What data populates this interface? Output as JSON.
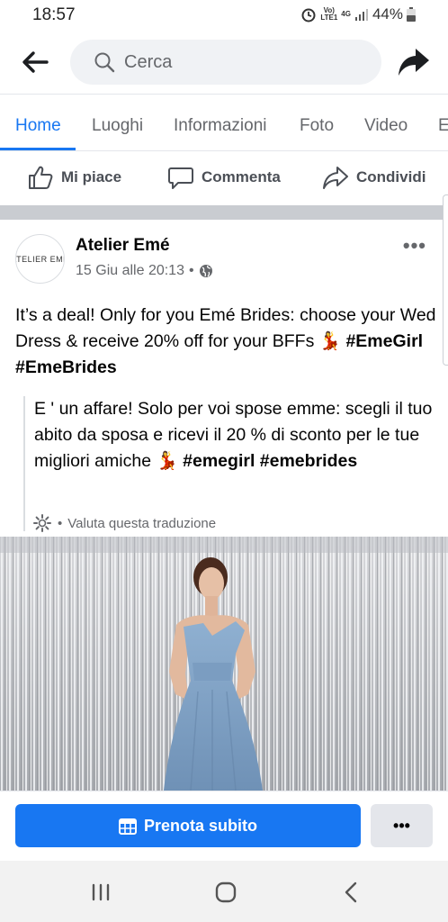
{
  "status": {
    "time": "18:57",
    "net_top": "Vo)",
    "net_bottom": "LTE1",
    "net_type": "4G",
    "battery": "44%"
  },
  "search": {
    "placeholder": "Cerca"
  },
  "tabs": [
    {
      "label": "Home"
    },
    {
      "label": "Luoghi"
    },
    {
      "label": "Informazioni"
    },
    {
      "label": "Foto"
    },
    {
      "label": "Video"
    },
    {
      "label": "E"
    }
  ],
  "actions": {
    "like": "Mi piace",
    "comment": "Commenta",
    "share": "Condividi"
  },
  "post": {
    "avatar_text": "ATELIER EMÉ",
    "author": "Atelier Emé",
    "date": "15 Giu alle 20:13",
    "separator": "•",
    "text_main": "It’s a deal! Only for you Emé Brides: choose your Wed Dress & receive 20% off for your BFFs 💃 ",
    "hashtags": "#EmeGirl #EmeBrides",
    "translation_main": "E ' un affare! Solo per voi spose emme: scegli il tuo abito da sposa e ricevi il 20 % di sconto per le tue migliori amiche 💃 ",
    "translation_hashtags": "#emegirl #emebrides",
    "translate_bullet": "•",
    "translate_label": "Valuta questa traduzione"
  },
  "cta": {
    "book_label": "Prenota subito",
    "more_label": "•••"
  },
  "colors": {
    "accent": "#1877f2",
    "background": "#ffffff",
    "separator": "#c9ccd1",
    "dress": "#86a7c9"
  },
  "icons": [
    "back-arrow-icon",
    "search-icon",
    "share-arrow-icon",
    "thumbs-up-icon",
    "comment-bubble-icon",
    "share-icon",
    "globe-icon",
    "gear-icon",
    "calendar-icon",
    "recent-apps-icon",
    "home-icon",
    "back-icon"
  ]
}
